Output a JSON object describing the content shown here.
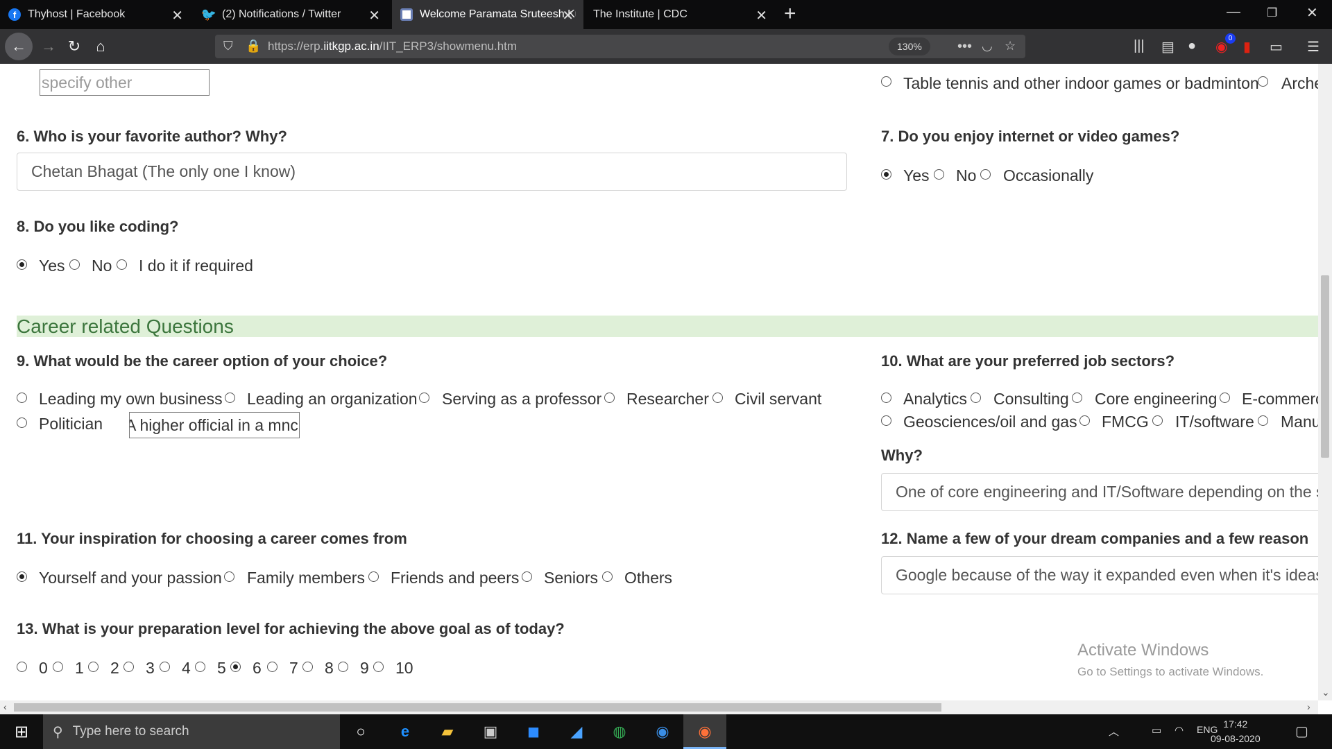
{
  "browser": {
    "tabs": [
      {
        "label": "Thyhost | Facebook"
      },
      {
        "label": "(2) Notifications / Twitter"
      },
      {
        "label": "Welcome Paramata Sruteesh Ku"
      },
      {
        "label": "The Institute | CDC"
      }
    ],
    "url_prefix": "https://erp.",
    "url_domain": "iitkgp.ac.in",
    "url_path": "/IIT_ERP3/showmenu.htm",
    "zoom": "130%"
  },
  "form": {
    "other_placeholder": "specify other",
    "sports_options": [
      "Table tennis and other indoor games or badminton",
      "Arche"
    ],
    "q6": {
      "label": "6. Who is your favorite author? Why?",
      "answer": "Chetan Bhagat (The only one I know)"
    },
    "q7": {
      "label": "7. Do you enjoy internet or video games?",
      "options": [
        "Yes",
        "No",
        "Occasionally"
      ],
      "selected": "Yes"
    },
    "q8": {
      "label": "8. Do you like coding?",
      "options": [
        "Yes",
        "No",
        "I do it if required"
      ],
      "selected": "Yes"
    },
    "section": "Career related Questions",
    "q9": {
      "label": "9. What would be the career option of your choice?",
      "options": [
        "Leading my own business",
        "Leading an organization",
        "Serving as a professor",
        "Researcher",
        "Civil servant",
        "Politician"
      ],
      "other_value": "A higher official in a mnc"
    },
    "q10": {
      "label": "10. What are your preferred job sectors?",
      "options": [
        "Analytics",
        "Consulting",
        "Core engineering",
        "E-commerc",
        "Geosciences/oil and gas",
        "FMCG",
        "IT/software",
        "Manu"
      ],
      "why_label": "Why?",
      "why_answer": "One of core engineering and IT/Software depending on the s"
    },
    "q11": {
      "label": "11. Your inspiration for choosing a career comes from",
      "options": [
        "Yourself and your passion",
        "Family members",
        "Friends and peers",
        "Seniors",
        "Others"
      ],
      "selected": "Yourself and your passion"
    },
    "q12": {
      "label": "12. Name a few of your dream companies and a few reason",
      "answer": "Google because of the way it expanded even when it's ideas"
    },
    "q13": {
      "label": "13. What is your preparation level for achieving the above goal as of today?",
      "options": [
        "0",
        "1",
        "2",
        "3",
        "4",
        "5",
        "6",
        "7",
        "8",
        "9",
        "10"
      ],
      "selected": "6"
    }
  },
  "watermark": {
    "title": "Activate Windows",
    "subtitle": "Go to Settings to activate Windows."
  },
  "taskbar": {
    "search_placeholder": "Type here to search",
    "lang": "ENG",
    "time": "17:42",
    "date": "09-08-2020",
    "notification_badge": "0"
  }
}
